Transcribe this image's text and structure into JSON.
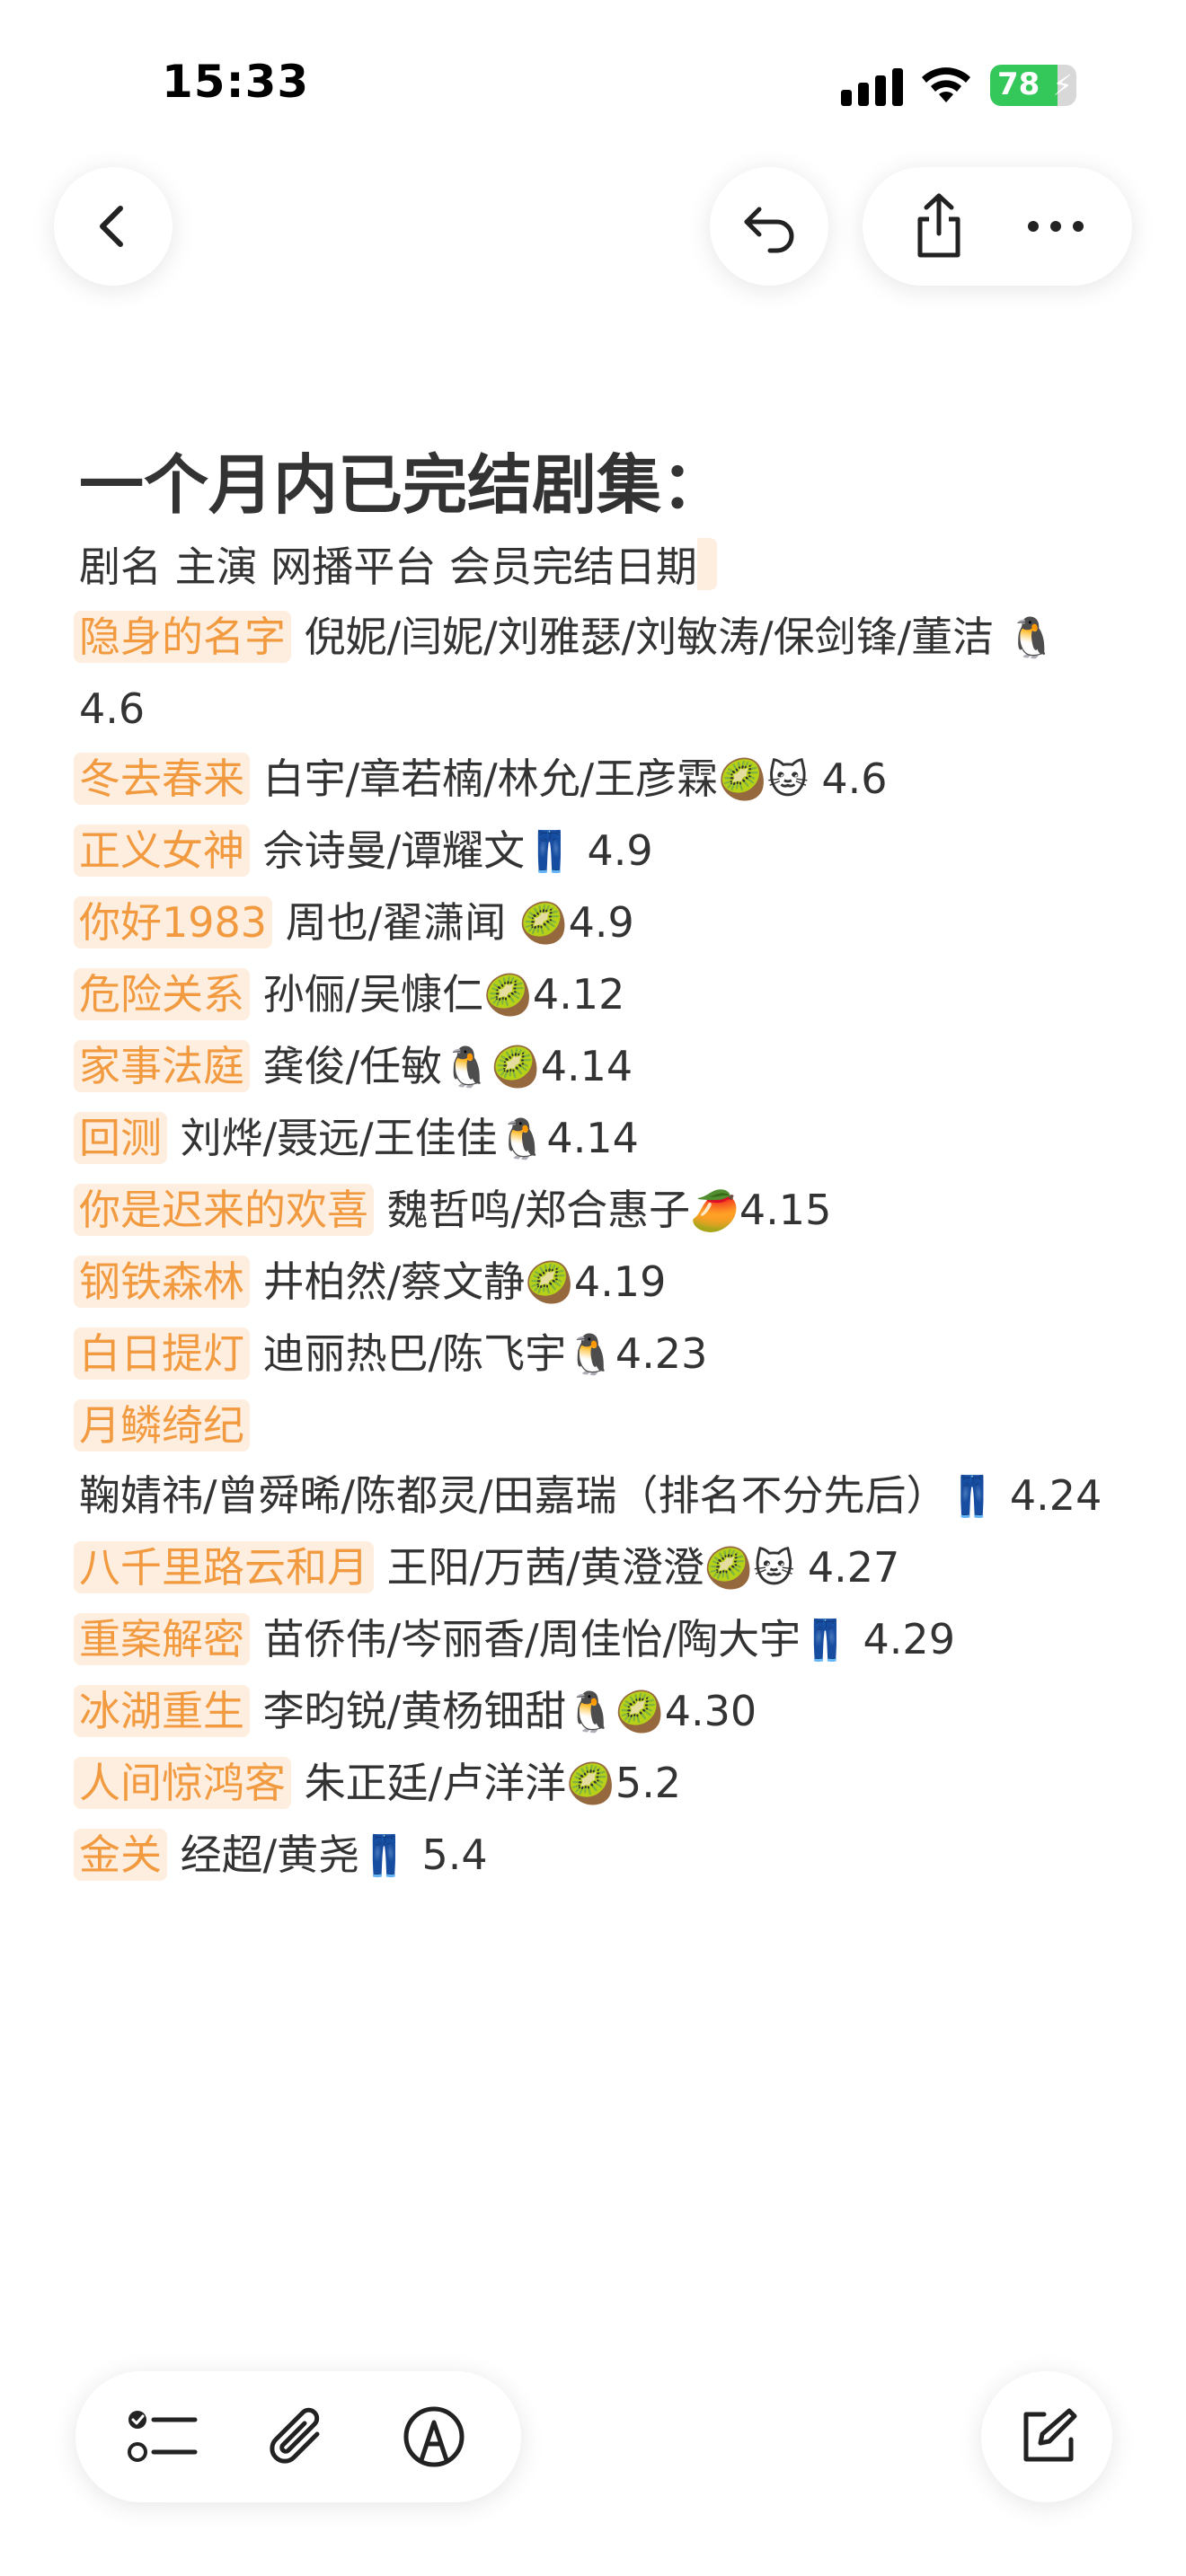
{
  "status": {
    "time": "15:33",
    "battery": "78",
    "battery_level": 78
  },
  "icons": {
    "back": "chevron-left-icon",
    "undo": "undo-icon",
    "share": "share-icon",
    "more": "more-icon",
    "checklist": "checklist-icon",
    "attach": "paperclip-icon",
    "markup": "pen-circle-icon",
    "compose": "compose-icon"
  },
  "colors": {
    "highlight_text": "#f29a3f",
    "highlight_bg": "#fdeee0",
    "battery_green": "#34c759"
  },
  "note": {
    "title": "一个月内已完结剧集：",
    "header": "剧名 主演 网播平台 会员完结日期",
    "entries": [
      {
        "drama": "隐身的名字",
        "cast": " 倪妮/闫妮/刘雅瑟/刘敏涛/保剑锋/董洁 ",
        "platform": "🐧",
        "date": "4.6"
      },
      {
        "drama": "冬去春来",
        "cast": " 白宇/章若楠/林允/王彦霖",
        "platform": "🥝🐱",
        "date": " 4.6"
      },
      {
        "drama": "正义女神",
        "cast": " 佘诗曼/谭耀文",
        "platform": "👖",
        "date": " 4.9"
      },
      {
        "drama": "你好1983",
        "cast": " 周也/翟潇闻 ",
        "platform": "🥝",
        "date": "4.9"
      },
      {
        "drama": "危险关系",
        "cast": " 孙俪/吴慷仁",
        "platform": "🥝",
        "date": "4.12"
      },
      {
        "drama": "家事法庭",
        "cast": " 龚俊/任敏",
        "platform": "🐧🥝",
        "date": "4.14"
      },
      {
        "drama": "回测",
        "cast": " 刘烨/聂远/王佳佳",
        "platform": "🐧",
        "date": "4.14"
      },
      {
        "drama": "你是迟来的欢喜",
        "cast": " 魏哲鸣/郑合惠子",
        "platform": "🥭",
        "date": "4.15"
      },
      {
        "drama": "钢铁森林",
        "cast": " 井柏然/蔡文静",
        "platform": "🥝",
        "date": "4.19"
      },
      {
        "drama": "白日提灯",
        "cast": " 迪丽热巴/陈飞宇",
        "platform": "🐧",
        "date": "4.23"
      },
      {
        "drama": "月鳞绮纪",
        "cast": " 鞠婧祎/曾舜晞/陈都灵/田嘉瑞（排名不分先后）",
        "platform": "👖",
        "date": " 4.24"
      },
      {
        "drama": "八千里路云和月",
        "cast": " 王阳/万茜/黄澄澄",
        "platform": "🥝🐱",
        "date": " 4.27"
      },
      {
        "drama": "重案解密",
        "cast": " 苗侨伟/岑丽香/周佳怡/陶大宇",
        "platform": "👖",
        "date": " 4.29"
      },
      {
        "drama": "冰湖重生",
        "cast": " 李昀锐/黄杨钿甜",
        "platform": "🐧🥝",
        "date": "4.30"
      },
      {
        "drama": "人间惊鸿客",
        "cast": " 朱正廷/卢洋洋",
        "platform": "🥝",
        "date": "5.2"
      },
      {
        "drama": "金关",
        "cast": " 经超/黄尧",
        "platform": "👖",
        "date": " 5.4"
      }
    ]
  }
}
